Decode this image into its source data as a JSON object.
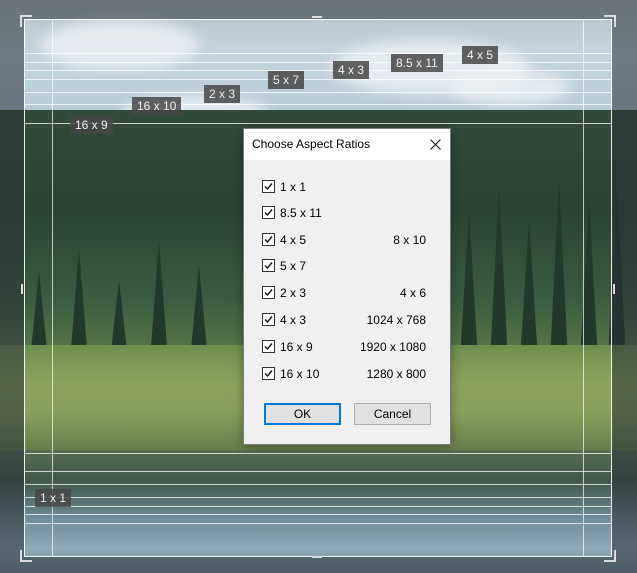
{
  "ratio_tags": {
    "r1x1": "1 x 1",
    "r8511": "8.5 x 11",
    "r4x5": "4 x 5",
    "r5x7": "5 x 7",
    "r2x3": "2 x 3",
    "r4x3": "4 x 3",
    "r16x9": "16 x 9",
    "r16x10": "16 x 10"
  },
  "dialog": {
    "title": "Choose Aspect Ratios",
    "items": [
      {
        "label": "1 x 1",
        "alt": "",
        "checked": true
      },
      {
        "label": "8.5 x 11",
        "alt": "",
        "checked": true
      },
      {
        "label": "4 x 5",
        "alt": "8 x 10",
        "checked": true
      },
      {
        "label": "5 x 7",
        "alt": "",
        "checked": true
      },
      {
        "label": "2 x 3",
        "alt": "4 x 6",
        "checked": true
      },
      {
        "label": "4 x 3",
        "alt": "1024 x 768",
        "checked": true
      },
      {
        "label": "16 x 9",
        "alt": "1920 x 1080",
        "checked": true
      },
      {
        "label": "16 x 10",
        "alt": "1280 x 800",
        "checked": true
      }
    ],
    "ok_label": "OK",
    "cancel_label": "Cancel"
  },
  "colors": {
    "accent": "#0078d7",
    "dialog_bg": "#f0f0f0"
  },
  "icons": {
    "close": "close-icon",
    "check": "checkmark-icon"
  }
}
